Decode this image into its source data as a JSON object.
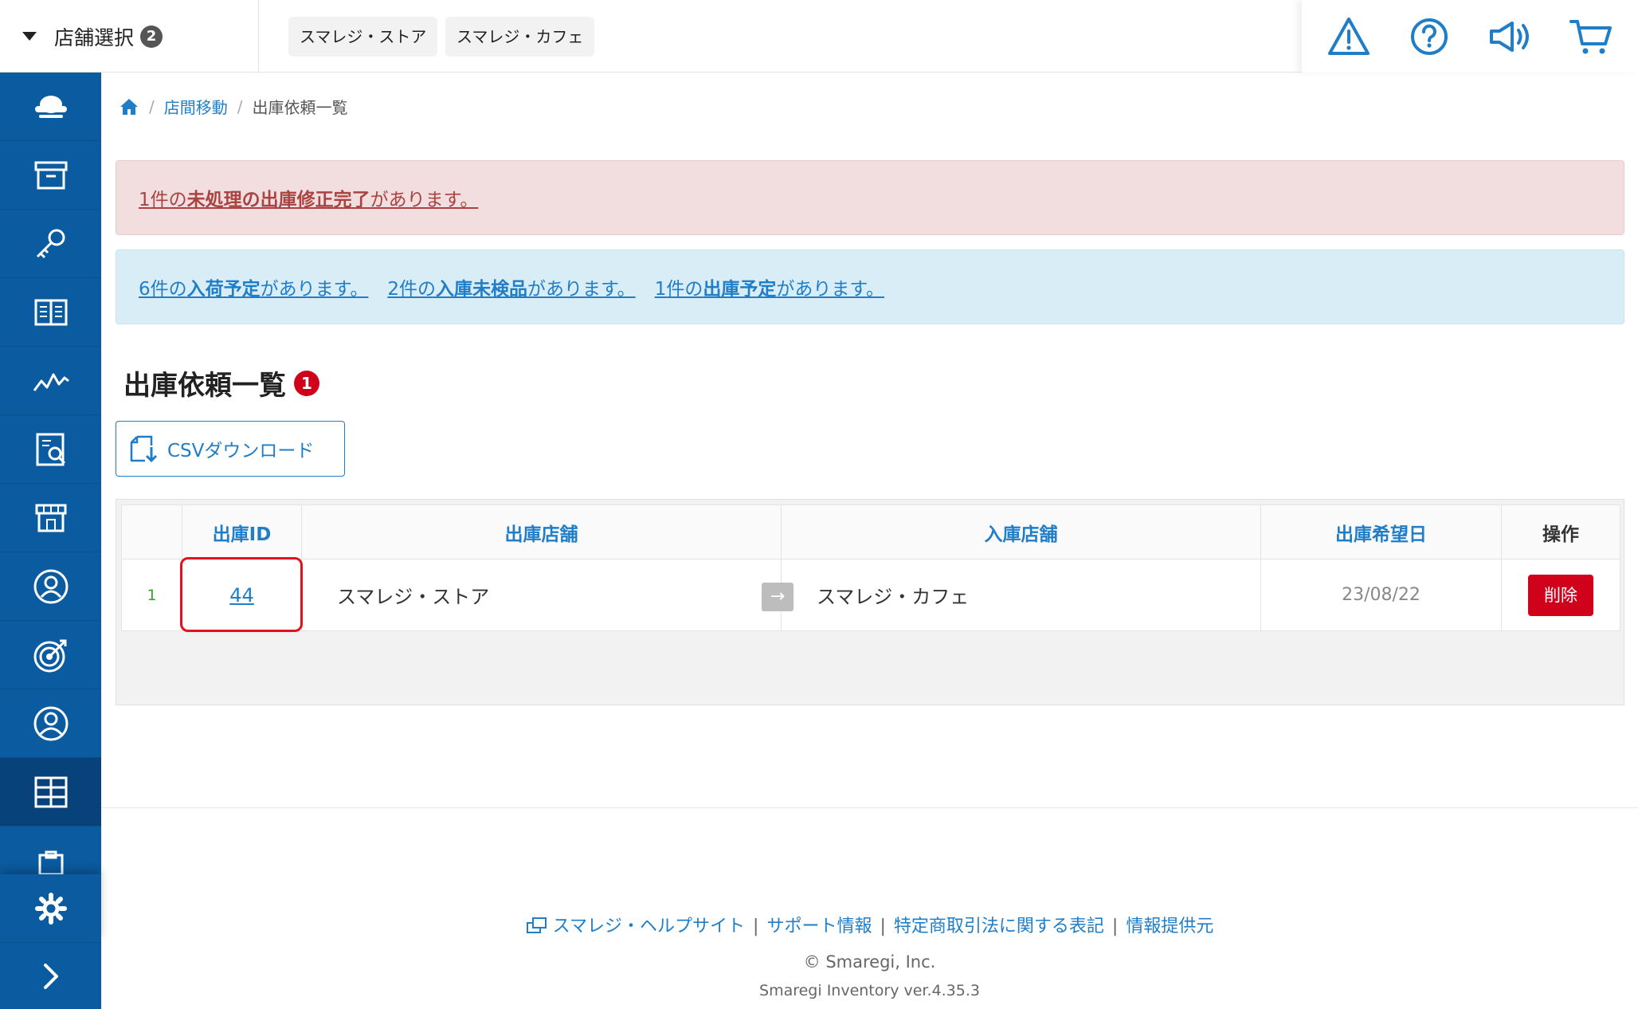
{
  "topbar": {
    "store_select_label": "店舗選択",
    "store_select_count": "2",
    "stores": [
      "スマレジ・ストア",
      "スマレジ・カフェ"
    ],
    "icons": [
      "warning-icon",
      "help-icon",
      "megaphone-icon",
      "cart-icon"
    ]
  },
  "sidebar": {
    "items": [
      "cloud-icon",
      "archive-icon",
      "key-icon",
      "book-icon",
      "chart-icon",
      "report-icon",
      "store-icon",
      "user-badge-icon",
      "target-icon",
      "user-icon",
      "grid-icon",
      "clipboard-icon"
    ],
    "active": "grid-icon",
    "settings_icon": "gear-icon",
    "expand_icon": "chevron-right-icon"
  },
  "breadcrumb": {
    "home_icon": "home-icon",
    "separator": "/",
    "items": [
      "店間移動",
      "出庫依頼一覧"
    ]
  },
  "alerts": {
    "danger": {
      "count": "1",
      "pre": "件の",
      "strong": "未処理の出庫修正完了",
      "post": "があります。"
    },
    "info": [
      {
        "count": "6",
        "pre": "件の",
        "strong": "入荷予定",
        "post": "があります。"
      },
      {
        "count": "2",
        "pre": "件の",
        "strong": "入庫未検品",
        "post": "があります。"
      },
      {
        "count": "1",
        "pre": "件の",
        "strong": "出庫予定",
        "post": "があります。"
      }
    ]
  },
  "page": {
    "title": "出庫依頼一覧",
    "badge": "1",
    "csv_label": "CSVダウンロード"
  },
  "table": {
    "headers": [
      "",
      "出庫ID",
      "出庫店舗",
      "入庫店舗",
      "出庫希望日",
      "操作"
    ],
    "rows": [
      {
        "num": "1",
        "id": "44",
        "from": "スマレジ・ストア",
        "to": "スマレジ・カフェ",
        "date": "23/08/22",
        "action": "削除"
      }
    ],
    "arrow": "→"
  },
  "footer": {
    "links": [
      "スマレジ・ヘルプサイト",
      "サポート情報",
      "特定商取引法に関する表記",
      "情報提供元"
    ],
    "pipe": "|",
    "copyright": "© Smaregi, Inc.",
    "version": "Smaregi Inventory ver.4.35.3"
  },
  "colors": {
    "sidebar": "#0a5ba0",
    "link": "#1f7ec7",
    "danger": "#d0021b"
  }
}
